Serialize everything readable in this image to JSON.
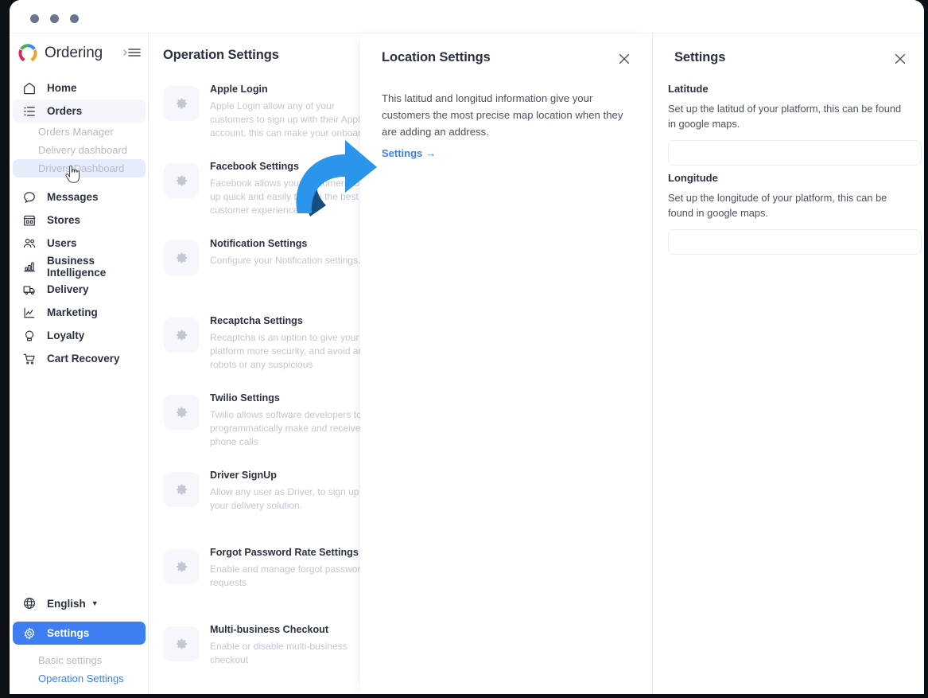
{
  "window": {
    "traffic_dots": [
      "dot-1",
      "dot-2",
      "dot-3"
    ]
  },
  "sidebar": {
    "brand": "Ordering",
    "collapse_icon": "collapse-menu-icon",
    "nav": [
      {
        "id": "home",
        "label": "Home",
        "icon": "home-icon"
      },
      {
        "id": "orders",
        "label": "Orders",
        "icon": "list-icon",
        "active": true
      },
      {
        "id": "messages",
        "label": "Messages",
        "icon": "chat-bubble-icon"
      },
      {
        "id": "stores",
        "label": "Stores",
        "icon": "store-icon"
      },
      {
        "id": "users",
        "label": "Users",
        "icon": "users-icon"
      },
      {
        "id": "business-intelligence",
        "label": "Business Intelligence",
        "icon": "bar-chart-icon"
      },
      {
        "id": "delivery",
        "label": "Delivery",
        "icon": "truck-icon"
      },
      {
        "id": "marketing",
        "label": "Marketing",
        "icon": "line-chart-icon"
      },
      {
        "id": "loyalty",
        "label": "Loyalty",
        "icon": "medal-icon"
      },
      {
        "id": "cart-recovery",
        "label": "Cart Recovery",
        "icon": "cart-icon"
      }
    ],
    "orders_subnav": [
      {
        "id": "orders-manager",
        "label": "Orders Manager"
      },
      {
        "id": "delivery-dashboard",
        "label": "Delivery dashboard"
      },
      {
        "id": "drivers-dashboard",
        "label": "Drivers Dashboard",
        "hovered": true
      }
    ],
    "language": {
      "label": "English",
      "icon": "globe-icon",
      "caret": "▼"
    },
    "settings_button": {
      "label": "Settings",
      "icon": "gear-icon"
    },
    "settings_subnav": [
      {
        "id": "basic-settings",
        "label": "Basic settings",
        "selected": false
      },
      {
        "id": "operation-settings",
        "label": "Operation Settings",
        "selected": true
      }
    ]
  },
  "operation": {
    "title": "Operation Settings",
    "items": [
      {
        "title": "Apple Login",
        "desc": "Apple Login allow any of your customers to sign up with their Apple account, this can make your onboarding"
      },
      {
        "title": "Facebook Settings",
        "desc": "Facebook allows your customers to sign up quick and easily to give the best customer experience"
      },
      {
        "title": "Notification Settings",
        "desc": "Configure your Notification settings."
      },
      {
        "title": "Recaptcha Settings",
        "desc": "Recaptcha is an option to give your platform more security, and avoid any robots or any suspicious"
      },
      {
        "title": "Twilio Settings",
        "desc": "Twilio allows software developers to programmatically make and receive phone calls"
      },
      {
        "title": "Driver SignUp",
        "desc": "Allow any user as Driver, to sign up for your delivery solution."
      },
      {
        "title": "Forgot Password Rate Settings",
        "desc": "Enable and manage forgot password requests"
      },
      {
        "title": "Multi-business Checkout",
        "desc": "Enable or disable multi-business checkout"
      }
    ]
  },
  "location_panel": {
    "title": "Location Settings",
    "close_icon": "close-icon",
    "description": "This latitud and longitud information give your customers the most precise map location when they are adding an address.",
    "link_label": "Settings",
    "link_arrow": "→"
  },
  "settings_panel": {
    "title": "Settings",
    "close_icon": "close-icon",
    "fields": [
      {
        "label": "Latitude",
        "desc": "Set up the latitud of your platform, this can be found in google maps.",
        "value": "",
        "placeholder": ""
      },
      {
        "label": "Longitude",
        "desc": "Set up the longitude of your platform, this can be found in google maps.",
        "value": "",
        "placeholder": ""
      }
    ]
  },
  "annotation": {
    "arrow_icon": "curved-arrow-right-icon",
    "arrow_color": "#2a95eb",
    "arrow_shadow_color": "#174d80"
  },
  "colors": {
    "accent_blue": "#3d7ff2",
    "text_dark": "#2a3140",
    "muted": "#c3c7d2",
    "panel_bg": "#ffffff",
    "tile_bg": "#f6f7fa"
  }
}
